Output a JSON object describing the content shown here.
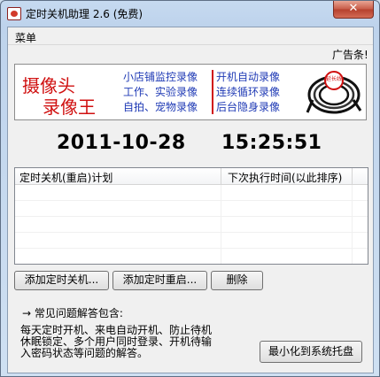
{
  "window": {
    "title": "定时关机助理 2.6 (免费)",
    "close_glyph": "✕"
  },
  "menu": {
    "items": [
      {
        "label": "菜单"
      }
    ]
  },
  "ad": {
    "label": "广告条!",
    "headline1": "摄像头",
    "headline2": "录像王",
    "col1": [
      "小店铺监控录像",
      "工作、实验录像",
      "自拍、宠物录像"
    ],
    "col2": [
      "开机自动录像",
      "连续循环录像",
      "后台隐身录像"
    ],
    "badge": "延长线"
  },
  "clock": {
    "date": "2011-10-28",
    "time": "15:25:51"
  },
  "schedule": {
    "columns": [
      "定时关机(重启)计划",
      "下次执行时间(以此排序)"
    ],
    "rows": []
  },
  "buttons": {
    "add_shutdown": "添加定时关机...",
    "add_restart": "添加定时重启...",
    "delete": "删除",
    "minimize_tray": "最小化到系统托盘"
  },
  "faq": {
    "title": "→ 常见问题解答包含:",
    "lines": [
      "每天定时开机、来电自动开机、防止待机",
      "休眠锁定、多个用户同时登录、开机待输",
      "入密码状态等问题的解答。"
    ]
  }
}
